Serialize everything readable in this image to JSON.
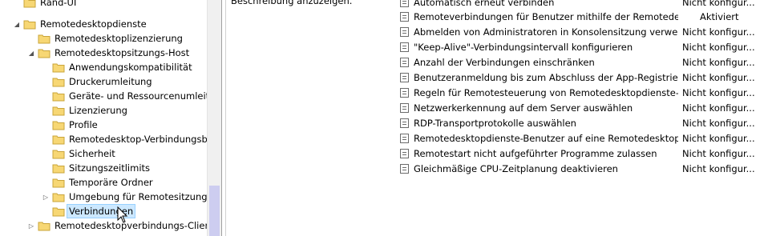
{
  "tree": {
    "items": [
      {
        "label": "Rand-UI",
        "expander": ""
      },
      {
        "label": "Remotedesktopdienste",
        "expander": "◢"
      },
      {
        "label": "Remotedesktoplizenzierung",
        "expander": ""
      },
      {
        "label": "Remotedesktopsitzungs-Host",
        "expander": "◢"
      },
      {
        "label": "Anwendungskompatibilität",
        "expander": ""
      },
      {
        "label": "Druckerumleitung",
        "expander": ""
      },
      {
        "label": "Geräte- und Ressourcenumleitung",
        "expander": ""
      },
      {
        "label": "Lizenzierung",
        "expander": ""
      },
      {
        "label": "Profile",
        "expander": ""
      },
      {
        "label": "Remotedesktop-Verbindungsbroker",
        "expander": ""
      },
      {
        "label": "Sicherheit",
        "expander": ""
      },
      {
        "label": "Sitzungszeitlimits",
        "expander": ""
      },
      {
        "label": "Temporäre Ordner",
        "expander": ""
      },
      {
        "label": "Umgebung für Remotesitzung",
        "expander": "▷"
      },
      {
        "label": "Verbindungen",
        "expander": ""
      },
      {
        "label": "Remotedesktopverbindungs-Client",
        "expander": "▷"
      }
    ]
  },
  "description": {
    "text": "Beschreibung anzuzeigen."
  },
  "settings": {
    "rows": [
      {
        "name": "Automatisch erneut verbinden",
        "state": "Nicht konfigur..."
      },
      {
        "name": "Remoteverbindungen für Benutzer mithilfe der Remotedesk...",
        "state": "Aktiviert"
      },
      {
        "name": "Abmelden von Administratoren in Konsolensitzung verweig...",
        "state": "Nicht konfigur..."
      },
      {
        "name": "\"Keep-Alive\"-Verbindungsintervall konfigurieren",
        "state": "Nicht konfigur..."
      },
      {
        "name": "Anzahl der Verbindungen einschränken",
        "state": "Nicht konfigur..."
      },
      {
        "name": "Benutzeranmeldung bis zum Abschluss der App-Registrieru...",
        "state": "Nicht konfigur..."
      },
      {
        "name": "Regeln für Remotesteuerung von Remotedesktopdienste-Be...",
        "state": "Nicht konfigur..."
      },
      {
        "name": "Netzwerkerkennung auf dem Server auswählen",
        "state": "Nicht konfigur..."
      },
      {
        "name": "RDP-Transportprotokolle auswählen",
        "state": "Nicht konfigur..."
      },
      {
        "name": "Remotedesktopdienste-Benutzer auf eine Remotedesktopdi...",
        "state": "Nicht konfigur..."
      },
      {
        "name": "Remotestart nicht aufgeführter Programme zulassen",
        "state": "Nicht konfigur..."
      },
      {
        "name": "Gleichmäßige CPU-Zeitplanung deaktivieren",
        "state": "Nicht konfigur..."
      }
    ]
  },
  "colors": {
    "selection": "#cce8ff",
    "folder": "#f7d774",
    "scroll_thumb": "#cdcdf0"
  },
  "icons": {
    "folder": "folder-icon",
    "setting": "policy-setting-icon",
    "cursor": "mouse-pointer-icon"
  }
}
